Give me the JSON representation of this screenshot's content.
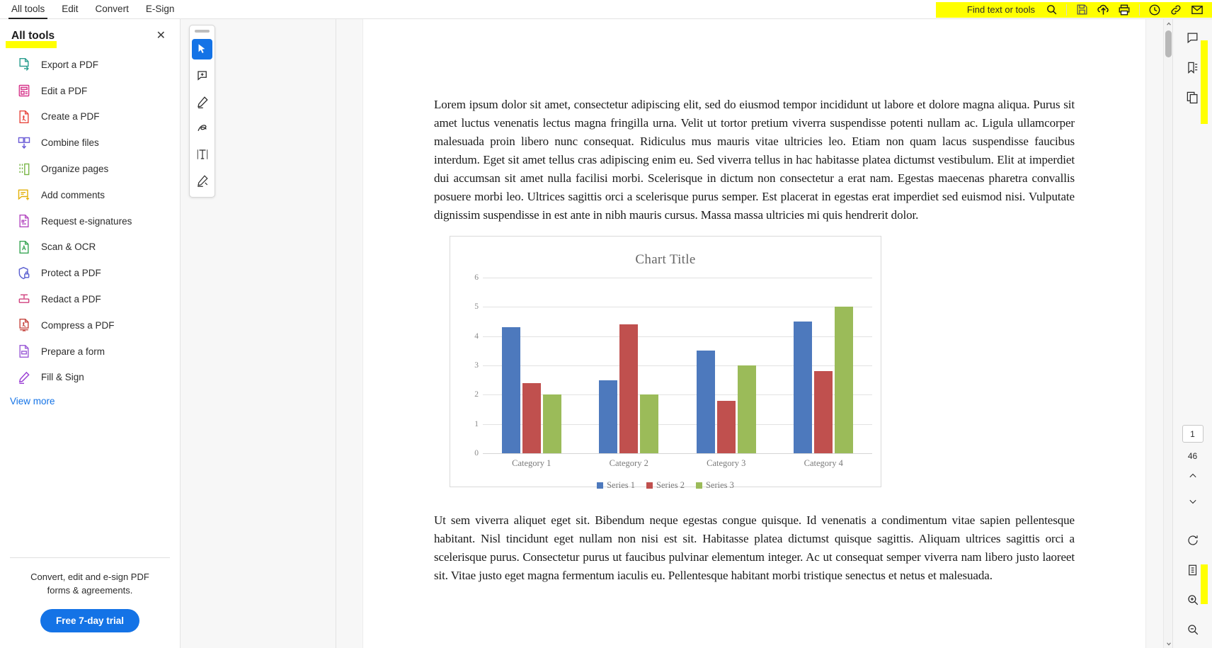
{
  "menu": {
    "tabs": [
      {
        "label": "All tools",
        "active": true
      },
      {
        "label": "Edit",
        "active": false
      },
      {
        "label": "Convert",
        "active": false
      },
      {
        "label": "E-Sign",
        "active": false
      }
    ]
  },
  "topbar": {
    "find_label": "Find text or tools",
    "icons": [
      "search-icon",
      "save-icon",
      "upload-cloud-icon",
      "print-icon",
      "history-clock-icon",
      "link-icon",
      "mail-icon"
    ]
  },
  "left_panel": {
    "title": "All tools",
    "close_label": "✕",
    "tools": [
      {
        "label": "Export a PDF",
        "icon": "export-pdf-icon",
        "color": "#2a9d8f"
      },
      {
        "label": "Edit a PDF",
        "icon": "edit-pdf-icon",
        "color": "#d6348a"
      },
      {
        "label": "Create a PDF",
        "icon": "create-pdf-icon",
        "color": "#e8483f"
      },
      {
        "label": "Combine files",
        "icon": "combine-files-icon",
        "color": "#6a5bd6"
      },
      {
        "label": "Organize pages",
        "icon": "organize-pages-icon",
        "color": "#7ab648"
      },
      {
        "label": "Add comments",
        "icon": "add-comments-icon",
        "color": "#e2b007"
      },
      {
        "label": "Request e-signatures",
        "icon": "request-esign-icon",
        "color": "#b44ac0"
      },
      {
        "label": "Scan & OCR",
        "icon": "scan-ocr-icon",
        "color": "#3aa655"
      },
      {
        "label": "Protect a PDF",
        "icon": "protect-pdf-icon",
        "color": "#5a5fd0"
      },
      {
        "label": "Redact a PDF",
        "icon": "redact-pdf-icon",
        "color": "#d0417e"
      },
      {
        "label": "Compress a PDF",
        "icon": "compress-pdf-icon",
        "color": "#c5463f"
      },
      {
        "label": "Prepare a form",
        "icon": "prepare-form-icon",
        "color": "#9b5bd6"
      },
      {
        "label": "Fill & Sign",
        "icon": "fill-sign-icon",
        "color": "#9b3fd4"
      }
    ],
    "view_more": "View more",
    "promo_line1": "Convert, edit and e-sign PDF",
    "promo_line2": "forms & agreements.",
    "trial_button": "Free 7-day trial"
  },
  "quick_tools": {
    "buttons": [
      {
        "icon": "select-cursor-icon",
        "selected": true
      },
      {
        "icon": "add-comment-icon",
        "selected": false
      },
      {
        "icon": "highlight-pen-icon",
        "selected": false
      },
      {
        "icon": "draw-freehand-icon",
        "selected": false
      },
      {
        "icon": "add-text-icon",
        "selected": false
      },
      {
        "icon": "sign-icon",
        "selected": false
      }
    ]
  },
  "document": {
    "paragraph_1": "Lorem ipsum dolor sit amet, consectetur adipiscing elit, sed do eiusmod tempor incididunt ut labore et dolore magna aliqua. Purus sit amet luctus venenatis lectus magna fringilla urna. Velit ut tortor pretium viverra suspendisse potenti nullam ac. Ligula ullamcorper malesuada proin libero nunc consequat. Ridiculus mus mauris vitae ultricies leo. Etiam non quam lacus suspendisse faucibus interdum. Eget sit amet tellus cras adipiscing enim eu. Sed viverra tellus in hac habitasse platea dictumst vestibulum. Elit at imperdiet dui accumsan sit amet nulla facilisi morbi. Scelerisque in dictum non consectetur a erat nam. Egestas maecenas pharetra convallis posuere morbi leo. Ultrices sagittis orci a scelerisque purus semper. Est placerat in egestas erat imperdiet sed euismod nisi. Vulputate dignissim suspendisse in est ante in nibh mauris cursus. Massa massa ultricies mi quis hendrerit dolor.",
    "paragraph_2": "Ut sem viverra aliquet eget sit. Bibendum neque egestas congue quisque. Id venenatis a condimentum vitae sapien pellentesque habitant. Nisl tincidunt eget nullam non nisi est sit. Habitasse platea dictumst quisque sagittis. Aliquam ultrices sagittis orci a scelerisque purus. Consectetur purus ut faucibus pulvinar elementum integer. Ac ut consequat semper viverra nam libero justo laoreet sit. Vitae justo eget magna fermentum iaculis eu. Pellentesque habitant morbi tristique senectus et netus et malesuada."
  },
  "chart_data": {
    "type": "bar",
    "title": "Chart Title",
    "categories": [
      "Category 1",
      "Category 2",
      "Category 3",
      "Category 4"
    ],
    "series": [
      {
        "name": "Series 1",
        "color": "#4d79bd",
        "values": [
          4.3,
          2.5,
          3.5,
          4.5
        ]
      },
      {
        "name": "Series 2",
        "color": "#c0504e",
        "values": [
          2.4,
          4.4,
          1.8,
          2.8
        ]
      },
      {
        "name": "Series 3",
        "color": "#9bbb59",
        "values": [
          2.0,
          2.0,
          3.0,
          5.0
        ]
      }
    ],
    "yticks": [
      6,
      5,
      4,
      3,
      2,
      1,
      0
    ],
    "ylim": [
      0,
      6
    ],
    "xlabel": "",
    "ylabel": "",
    "grid": true,
    "legend_position": "bottom"
  },
  "right_rail": {
    "top_icons": [
      "comment-bubble-icon",
      "bookmark-list-icon",
      "pages-thumbnail-icon"
    ],
    "page_current": "1",
    "page_total": "46",
    "nav_up": "⌃",
    "nav_down": "⌄",
    "bottom_icons": [
      "rotate-icon",
      "page-fit-icon",
      "zoom-in-icon",
      "zoom-out-icon"
    ]
  },
  "colors": {
    "accent_blue": "#1473e6",
    "highlight_yellow": "#ffff00",
    "series1": "#4d79bd",
    "series2": "#c0504e",
    "series3": "#9bbb59"
  }
}
